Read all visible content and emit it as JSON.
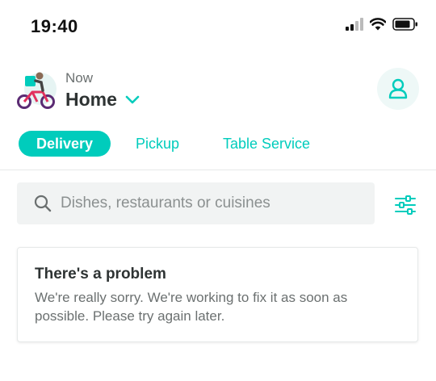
{
  "status_bar": {
    "time": "19:40",
    "icons": [
      "cellular-signal-icon",
      "wifi-icon",
      "battery-icon"
    ]
  },
  "header": {
    "delivery_time": "Now",
    "location": "Home",
    "icons": [
      "rider-illustration",
      "chevron-down-icon",
      "account-icon"
    ]
  },
  "tabs": [
    {
      "label": "Delivery",
      "active": true
    },
    {
      "label": "Pickup",
      "active": false
    },
    {
      "label": "Table Service",
      "active": false
    }
  ],
  "search": {
    "placeholder": "Dishes, restaurants or cuisines",
    "value": ""
  },
  "error": {
    "title": "There's a problem",
    "message": "We're really sorry. We're working to fix it as soon as possible. Please try again later."
  },
  "colors": {
    "accent": "#00ccbc",
    "text": "#2e3333",
    "muted": "#6b7070",
    "search_bg": "#f1f3f3"
  }
}
